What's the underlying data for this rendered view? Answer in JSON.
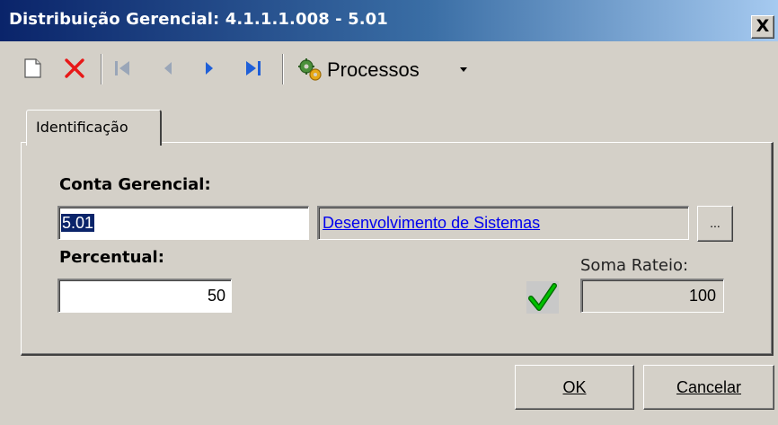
{
  "window": {
    "title": "Distribuição Gerencial: 4.1.1.1.008 - 5.01",
    "close_label": "X"
  },
  "toolbar": {
    "items": [
      {
        "icon": "new-document-icon"
      },
      {
        "icon": "delete-icon",
        "color": "#e81818"
      },
      {
        "icon": "first-record-icon"
      },
      {
        "icon": "previous-record-icon"
      },
      {
        "icon": "next-record-icon",
        "color": "#1f5fd8"
      },
      {
        "icon": "last-record-icon",
        "color": "#1f5fd8"
      }
    ],
    "processos_label": "Processos",
    "processos_icon": "gears-icon"
  },
  "tabs": [
    {
      "label": "Identificação",
      "active": true
    }
  ],
  "form": {
    "conta_label": "Conta Gerencial:",
    "conta_value": "5.01",
    "conta_description": "Desenvolvimento de Sistemas",
    "lookup_button_label": "...",
    "percentual_label": "Percentual:",
    "percentual_value": "50",
    "soma_label": "Soma Rateio:",
    "soma_value": "100",
    "status_icon": "checkmark-icon",
    "status_color": "#00c000"
  },
  "buttons": {
    "ok": "OK",
    "cancel": "Cancelar"
  }
}
